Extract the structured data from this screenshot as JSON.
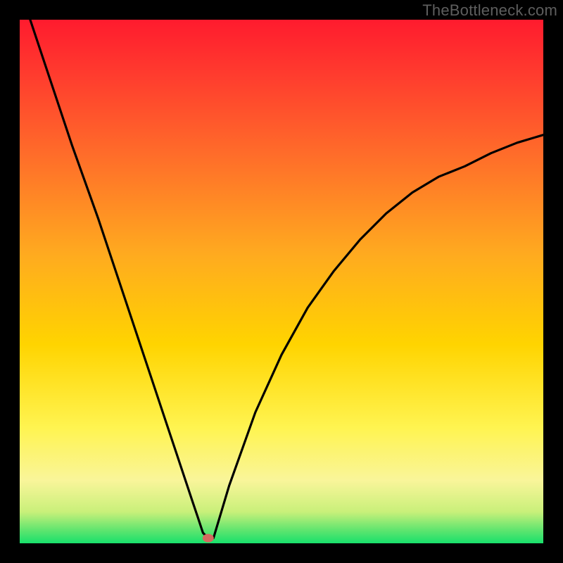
{
  "watermark": "TheBottleneck.com",
  "colors": {
    "frame": "#000000",
    "gradient_top": "#ff1b2e",
    "gradient_mid": "#ffd400",
    "gradient_low": "#f9f59a",
    "gradient_bottom": "#18e06b",
    "curve": "#000000",
    "marker": "#d46a5f",
    "watermark": "#5e5e5e"
  },
  "chart_data": {
    "type": "line",
    "title": "",
    "xlabel": "",
    "ylabel": "",
    "xlim": [
      0,
      100
    ],
    "ylim": [
      0,
      100
    ],
    "x": [
      2,
      5,
      10,
      15,
      20,
      25,
      28,
      30,
      32,
      33,
      34,
      35,
      36,
      37,
      40,
      45,
      50,
      55,
      60,
      65,
      70,
      75,
      80,
      85,
      90,
      95,
      100
    ],
    "values": [
      100,
      91,
      76,
      62,
      47,
      32,
      23,
      17,
      11,
      8,
      5,
      2,
      1,
      1,
      11,
      25,
      36,
      45,
      52,
      58,
      63,
      67,
      70,
      72,
      74.5,
      76.5,
      78
    ],
    "marker": {
      "x": 36,
      "y": 1
    },
    "note": "x,y are percent of plot area; (0,0)=bottom-left, (100,100)=top-left. Values read from gridless heatmap-like gradient chart by visual estimation."
  }
}
